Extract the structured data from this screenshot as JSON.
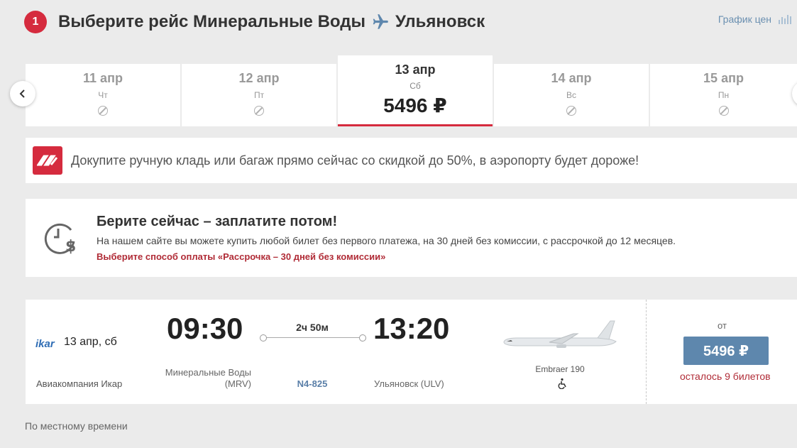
{
  "header": {
    "step": "1",
    "title_prefix": "Выберите рейс",
    "from_city": "Минеральные Воды",
    "to_city": "Ульяновск",
    "price_graph_label": "График цен"
  },
  "dates": [
    {
      "date": "11 апр",
      "weekday": "Чт",
      "available": false
    },
    {
      "date": "12 апр",
      "weekday": "Пт",
      "available": false
    },
    {
      "date": "13 апр",
      "weekday": "Сб",
      "price": "5496 ₽",
      "available": true,
      "selected": true
    },
    {
      "date": "14 апр",
      "weekday": "Вс",
      "available": false
    },
    {
      "date": "15 апр",
      "weekday": "Пн",
      "available": false
    }
  ],
  "promo": {
    "text": "Докупите ручную кладь или багаж прямо сейчас со скидкой до 50%, в аэропорту будет дороже!"
  },
  "bnpl": {
    "title": "Берите сейчас – заплатите потом!",
    "subtitle": "На нашем сайте вы можете купить любой билет без первого платежа, на 30 дней без комиссии, с рассрочкой до 12 месяцев.",
    "link": "Выберите способ оплаты «Рассрочка – 30 дней без комиссии»"
  },
  "flight": {
    "airline_logo": "ikar",
    "date": "13 апр, сб",
    "airline": "Авиакомпания Икар",
    "dep_time": "09:30",
    "dep_city": "Минеральные Воды",
    "dep_code": "(MRV)",
    "duration": "2ч 50м",
    "flight_number": "N4-825",
    "arr_time": "13:20",
    "arr_city": "Ульяновск (ULV)",
    "aircraft": "Embraer 190",
    "price_from": "от",
    "price": "5496 ₽",
    "tickets_left": "осталось 9 билетов"
  },
  "footer": {
    "note": "По местному времени"
  },
  "colors": {
    "brand_red": "#d52b3e",
    "button_blue": "#5e87ad",
    "link_red": "#b02b36"
  }
}
